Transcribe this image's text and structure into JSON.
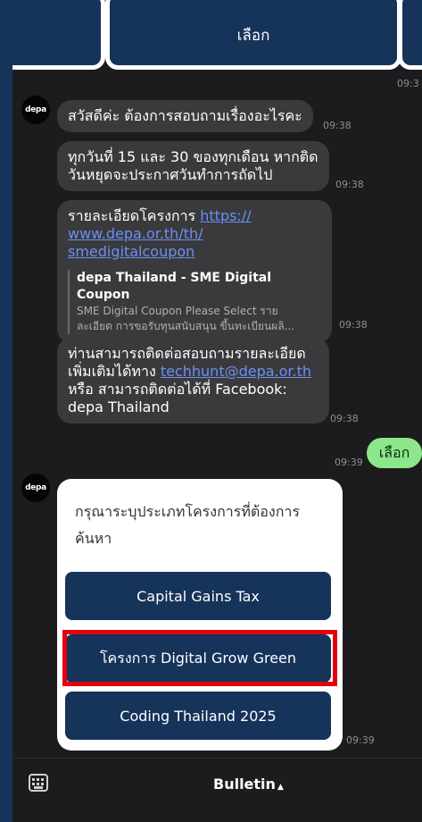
{
  "top_carousel": {
    "center_label": "เลือก",
    "time": "09:3"
  },
  "avatar_label": "depa",
  "messages": [
    {
      "text": "สวัสดีค่ะ ต้องการสอบถามเรื่องอะไรคะ",
      "time": "09:38"
    },
    {
      "text_line1": "ทุกวันที่ 15 และ 30 ของทุกเดือน หากติด",
      "text_line2": "วันหยุดจะประกาศวันทำการถัดไป",
      "time": "09:38"
    },
    {
      "prefix": "รายละเอียดโครงการ ",
      "link_line1": "https://",
      "link_line2": "www.depa.or.th/th/",
      "link_line3": "smedigitalcoupon",
      "preview_title": "depa Thailand - SME Digital Coupon",
      "preview_line1": "SME Digital Coupon Please Select ราย",
      "preview_line2": "ละเอียด การขอรับทุนสนับสนุน ขึ้นทะเบียนผลิ...",
      "time": "09:38"
    },
    {
      "line1": "ท่านสามารถติดต่อสอบถามรายละเอียด",
      "line2_prefix": "เพิ่มเติมได้ทาง ",
      "email": "techhunt@depa.or.th",
      "line3": "หรือ สามารถติดต่อได้ที่ Facebook:",
      "line4": "depa Thailand",
      "time": "09:38"
    }
  ],
  "user_message": {
    "text": "เลือก",
    "time": "09:39"
  },
  "options_panel": {
    "prompt": "กรุณาระบุประเภทโครงการที่ต้องการค้นหา",
    "options": [
      "Capital Gains Tax",
      "โครงการ Digital Grow Green",
      "Coding Thailand 2025"
    ],
    "time": "09:39"
  },
  "bottom_bar": {
    "menu_label": "Bulletin",
    "caret": "▲"
  },
  "colors": {
    "navy": "#16335a",
    "highlight": "#e3000f",
    "user_bubble": "#8de68a",
    "link": "#6b8ff5"
  }
}
